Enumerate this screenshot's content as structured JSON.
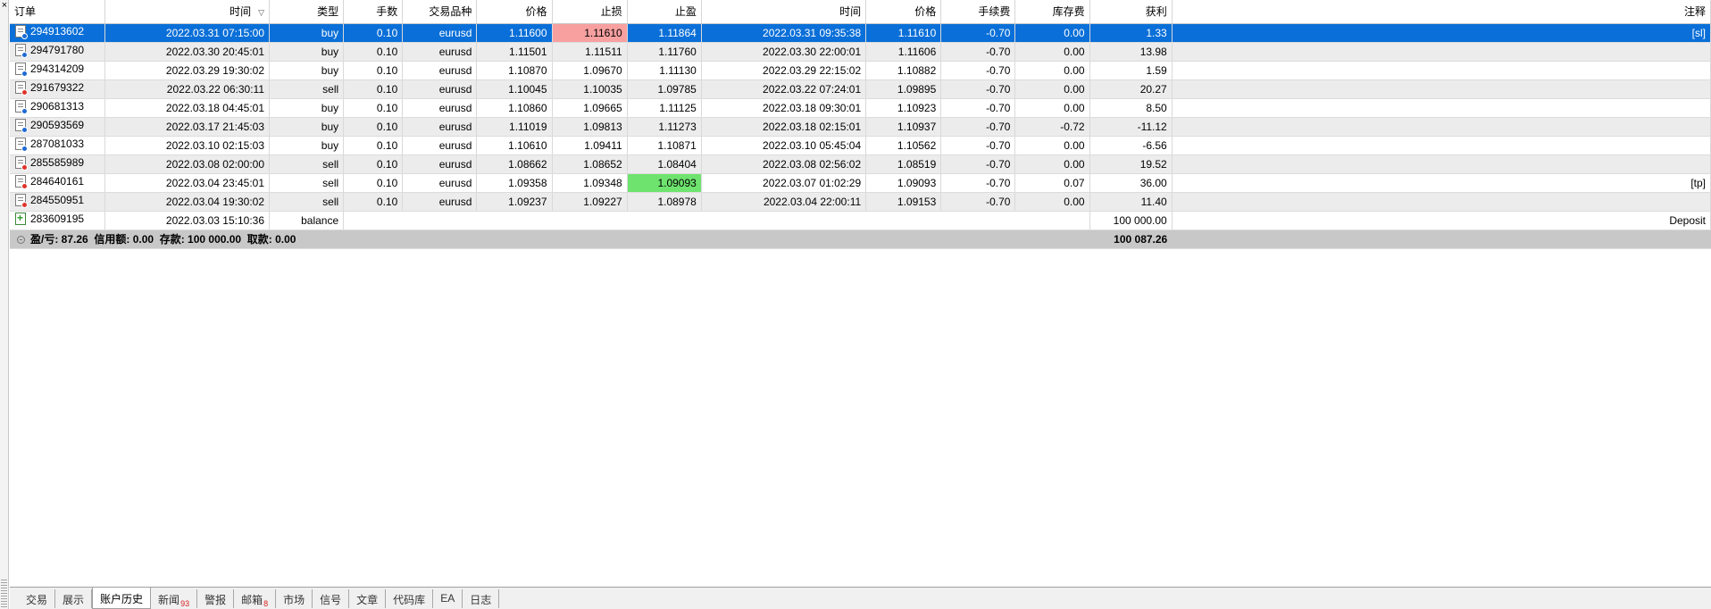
{
  "columns": [
    "订单",
    "时间",
    "类型",
    "手数",
    "交易品种",
    "价格",
    "止损",
    "止盈",
    "时间",
    "价格",
    "手续费",
    "库存费",
    "获利",
    "注释"
  ],
  "sort_indicator": "▽",
  "rows": [
    {
      "order": "294913602",
      "open_time": "2022.03.31 07:15:00",
      "type": "buy",
      "volume": "0.10",
      "symbol": "eurusd",
      "price": "1.11600",
      "sl": "1.11610",
      "tp": "1.11864",
      "close_time": "2022.03.31 09:35:38",
      "close_price": "1.11610",
      "commission": "-0.70",
      "swap": "0.00",
      "profit": "1.33",
      "comment": "[sl]"
    },
    {
      "order": "294791780",
      "open_time": "2022.03.30 20:45:01",
      "type": "buy",
      "volume": "0.10",
      "symbol": "eurusd",
      "price": "1.11501",
      "sl": "1.11511",
      "tp": "1.11760",
      "close_time": "2022.03.30 22:00:01",
      "close_price": "1.11606",
      "commission": "-0.70",
      "swap": "0.00",
      "profit": "13.98",
      "comment": ""
    },
    {
      "order": "294314209",
      "open_time": "2022.03.29 19:30:02",
      "type": "buy",
      "volume": "0.10",
      "symbol": "eurusd",
      "price": "1.10870",
      "sl": "1.09670",
      "tp": "1.11130",
      "close_time": "2022.03.29 22:15:02",
      "close_price": "1.10882",
      "commission": "-0.70",
      "swap": "0.00",
      "profit": "1.59",
      "comment": ""
    },
    {
      "order": "291679322",
      "open_time": "2022.03.22 06:30:11",
      "type": "sell",
      "volume": "0.10",
      "symbol": "eurusd",
      "price": "1.10045",
      "sl": "1.10035",
      "tp": "1.09785",
      "close_time": "2022.03.22 07:24:01",
      "close_price": "1.09895",
      "commission": "-0.70",
      "swap": "0.00",
      "profit": "20.27",
      "comment": ""
    },
    {
      "order": "290681313",
      "open_time": "2022.03.18 04:45:01",
      "type": "buy",
      "volume": "0.10",
      "symbol": "eurusd",
      "price": "1.10860",
      "sl": "1.09665",
      "tp": "1.11125",
      "close_time": "2022.03.18 09:30:01",
      "close_price": "1.10923",
      "commission": "-0.70",
      "swap": "0.00",
      "profit": "8.50",
      "comment": ""
    },
    {
      "order": "290593569",
      "open_time": "2022.03.17 21:45:03",
      "type": "buy",
      "volume": "0.10",
      "symbol": "eurusd",
      "price": "1.11019",
      "sl": "1.09813",
      "tp": "1.11273",
      "close_time": "2022.03.18 02:15:01",
      "close_price": "1.10937",
      "commission": "-0.70",
      "swap": "-0.72",
      "profit": "-11.12",
      "comment": ""
    },
    {
      "order": "287081033",
      "open_time": "2022.03.10 02:15:03",
      "type": "buy",
      "volume": "0.10",
      "symbol": "eurusd",
      "price": "1.10610",
      "sl": "1.09411",
      "tp": "1.10871",
      "close_time": "2022.03.10 05:45:04",
      "close_price": "1.10562",
      "commission": "-0.70",
      "swap": "0.00",
      "profit": "-6.56",
      "comment": ""
    },
    {
      "order": "285585989",
      "open_time": "2022.03.08 02:00:00",
      "type": "sell",
      "volume": "0.10",
      "symbol": "eurusd",
      "price": "1.08662",
      "sl": "1.08652",
      "tp": "1.08404",
      "close_time": "2022.03.08 02:56:02",
      "close_price": "1.08519",
      "commission": "-0.70",
      "swap": "0.00",
      "profit": "19.52",
      "comment": ""
    },
    {
      "order": "284640161",
      "open_time": "2022.03.04 23:45:01",
      "type": "sell",
      "volume": "0.10",
      "symbol": "eurusd",
      "price": "1.09358",
      "sl": "1.09348",
      "tp": "1.09093",
      "close_time": "2022.03.07 01:02:29",
      "close_price": "1.09093",
      "commission": "-0.70",
      "swap": "0.07",
      "profit": "36.00",
      "comment": "[tp]"
    },
    {
      "order": "284550951",
      "open_time": "2022.03.04 19:30:02",
      "type": "sell",
      "volume": "0.10",
      "symbol": "eurusd",
      "price": "1.09237",
      "sl": "1.09227",
      "tp": "1.08978",
      "close_time": "2022.03.04 22:00:11",
      "close_price": "1.09153",
      "commission": "-0.70",
      "swap": "0.00",
      "profit": "11.40",
      "comment": ""
    }
  ],
  "balance_row": {
    "order": "283609195",
    "time": "2022.03.03 15:10:36",
    "type": "balance",
    "amount": "100 000.00",
    "comment": "Deposit"
  },
  "summary": {
    "text": "盈/亏: 87.26  信用额: 0.00  存款: 100 000.00  取款: 0.00",
    "total": "100 087.26"
  },
  "tabs": [
    {
      "label": "交易",
      "badge": ""
    },
    {
      "label": "展示",
      "badge": ""
    },
    {
      "label": "账户历史",
      "badge": "",
      "active": true
    },
    {
      "label": "新闻",
      "badge": "93"
    },
    {
      "label": "警报",
      "badge": ""
    },
    {
      "label": "邮箱",
      "badge": "8"
    },
    {
      "label": "市场",
      "badge": ""
    },
    {
      "label": "信号",
      "badge": ""
    },
    {
      "label": "文章",
      "badge": ""
    },
    {
      "label": "代码库",
      "badge": ""
    },
    {
      "label": "EA",
      "badge": ""
    },
    {
      "label": "日志",
      "badge": ""
    }
  ],
  "colors": {
    "selected_row": "#0a6fd8",
    "sl_highlight": "#f8a0a0",
    "tp_highlight": "#6ee36e",
    "buy_dot": "#1e6ad6",
    "sell_dot": "#e0322a"
  },
  "icons": {
    "close": "close-icon",
    "order": "order-document-icon",
    "balance": "balance-deposit-icon",
    "summary": "summary-icon"
  }
}
